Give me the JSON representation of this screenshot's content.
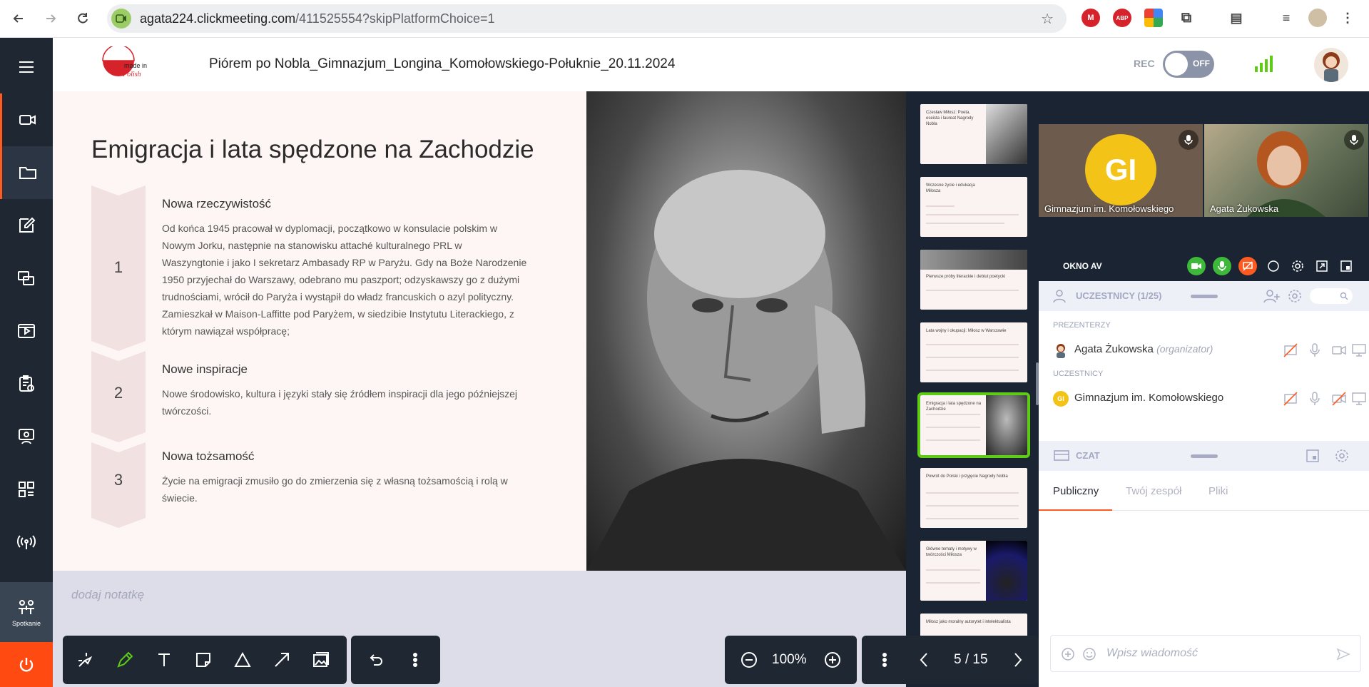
{
  "browser": {
    "url_host": "agata224.clickmeeting.com",
    "url_path": "/411525554?skipPlatformChoice=1",
    "ext_labels": [
      "M",
      "ABP"
    ]
  },
  "header": {
    "logo_text_line1": "made in",
    "logo_text_line2": "Polish",
    "title": "Piórem po Nobla_Gimnazjum_Longina_Komołowskiego-Połuknie_20.11.2024",
    "rec_label": "REC",
    "rec_state": "OFF"
  },
  "sidebar": {
    "meeting_label": "Spotkanie"
  },
  "slide": {
    "title": "Emigracja i lata spędzone na Zachodzie",
    "sections": [
      {
        "num": "1",
        "heading": "Nowa rzeczywistość",
        "lines": [
          "Od końca 1945 pracował w dyplomacji, początkowo w konsulacie polskim w",
          "Nowym Jorku, następnie na stanowisku attaché kulturalnego PRL w",
          "Waszyngtonie i jako I sekretarz Ambasady RP w Paryżu. Gdy na Boże Narodzenie",
          "1950 przyjechał do Warszawy, odebrano mu paszport; odzyskawszy go z dużymi",
          "trudnościami, wrócił do Paryża i wystąpił do władz francuskich o azyl polityczny.",
          "Zamieszkał w Maison-Laffitte pod Paryżem, w siedzibie Instytutu Literackiego, z",
          "którym nawiązał współpracę;"
        ]
      },
      {
        "num": "2",
        "heading": "Nowe inspiracje",
        "lines": [
          "Nowe środowisko, kultura i języki stały się źródłem inspiracji dla jego późniejszej",
          "twórczości."
        ]
      },
      {
        "num": "3",
        "heading": "Nowa tożsamość",
        "lines": [
          "Życie na emigracji zmusiło go do zmierzenia się z własną tożsamością i rolą w",
          "świecie."
        ]
      }
    ]
  },
  "notes": {
    "placeholder": "dodaj notatkę"
  },
  "thumbnails": [
    {
      "title": "Czesław Miłosz: Poeta, eseista i laureat Nagrody Nobla",
      "has_image": true
    },
    {
      "title": "Wczesne życie i edukacja Miłosza",
      "has_image": false
    },
    {
      "title": "Pierwsze próby literackie i debiut poetycki",
      "has_image": true
    },
    {
      "title": "Lata wojny i okupacji: Miłosz w Warszawie",
      "has_image": false
    },
    {
      "title": "Emigracja i lata spędzone na Zachodzie",
      "has_image": true,
      "active": true
    },
    {
      "title": "Powrót do Polski i przyjęcie Nagrody Nobla",
      "has_image": false
    },
    {
      "title": "Główne tematy i motywy w twórczości Miłosza",
      "has_image": true
    },
    {
      "title": "Miłosz jako moralny autorytet i intelektualista",
      "has_image": false
    }
  ],
  "video": {
    "tiles": [
      {
        "initials": "GI",
        "name": "Gimnazjum im. Komołowskiego"
      },
      {
        "initials": "",
        "name": "Agata Żukowska"
      }
    ],
    "av_title": "OKNO AV"
  },
  "participants": {
    "header": "UCZESTNICY (1/25)",
    "presenters_label": "PREZENTERZY",
    "attendees_label": "UCZESTNICY",
    "presenter": {
      "name": "Agata Żukowska",
      "role": "(organizator)"
    },
    "attendee": {
      "initials": "GI",
      "name": "Gimnazjum im. Komołowskiego"
    }
  },
  "chat": {
    "header": "CZAT",
    "tabs": [
      "Publiczny",
      "Twój zespół",
      "Pliki"
    ],
    "placeholder": "Wpisz wiadomość"
  },
  "toolbar": {
    "zoom": "100%",
    "page": "5 / 15"
  },
  "colors": {
    "accent": "#ff5a1f",
    "sidebar": "#1f2733",
    "active_thumb": "#5ecb14",
    "gi_avatar": "#f3c417"
  }
}
